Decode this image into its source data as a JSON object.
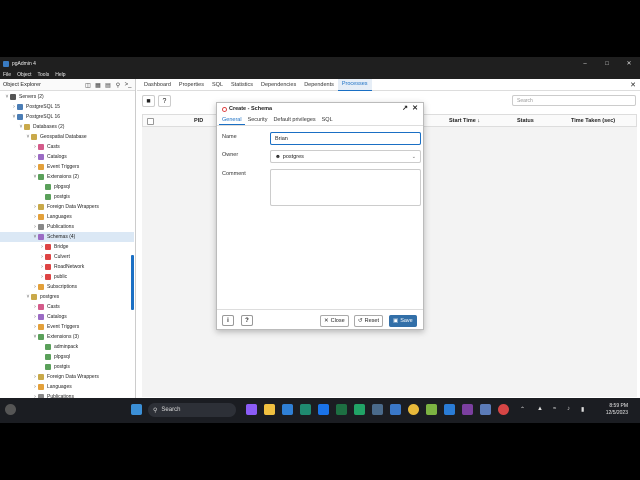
{
  "app": {
    "title": "pgAdmin 4"
  },
  "menu": [
    "File",
    "Object",
    "Tools",
    "Help"
  ],
  "explorer": {
    "title": "Object Explorer",
    "tree": [
      {
        "label": "Servers (2)",
        "indent": 0,
        "chev": "v",
        "color": "#555"
      },
      {
        "label": "PostgreSQL 15",
        "indent": 1,
        "chev": ">",
        "color": "#4b7db5"
      },
      {
        "label": "PostgreSQL 16",
        "indent": 1,
        "chev": "v",
        "color": "#4b7db5"
      },
      {
        "label": "Databases (2)",
        "indent": 2,
        "chev": "v",
        "color": "#c9a94a"
      },
      {
        "label": "Geospatial Database",
        "indent": 3,
        "chev": "v",
        "color": "#c9a94a"
      },
      {
        "label": "Casts",
        "indent": 4,
        "chev": ">",
        "color": "#d45b8a"
      },
      {
        "label": "Catalogs",
        "indent": 4,
        "chev": ">",
        "color": "#9b6bc4"
      },
      {
        "label": "Event Triggers",
        "indent": 4,
        "chev": ">",
        "color": "#e3a03a"
      },
      {
        "label": "Extensions (2)",
        "indent": 4,
        "chev": "v",
        "color": "#5aa05a"
      },
      {
        "label": "plpgsql",
        "indent": 5,
        "chev": "",
        "color": "#5aa05a"
      },
      {
        "label": "postgis",
        "indent": 5,
        "chev": "",
        "color": "#5aa05a"
      },
      {
        "label": "Foreign Data Wrappers",
        "indent": 4,
        "chev": ">",
        "color": "#c9a94a"
      },
      {
        "label": "Languages",
        "indent": 4,
        "chev": ">",
        "color": "#e3a03a"
      },
      {
        "label": "Publications",
        "indent": 4,
        "chev": ">",
        "color": "#888"
      },
      {
        "label": "Schemas (4)",
        "indent": 4,
        "chev": "v",
        "color": "#9b6bc4",
        "selected": true
      },
      {
        "label": "Bridge",
        "indent": 5,
        "chev": ">",
        "color": "#d44"
      },
      {
        "label": "Culvert",
        "indent": 5,
        "chev": ">",
        "color": "#d44"
      },
      {
        "label": "RoadNetwork",
        "indent": 5,
        "chev": ">",
        "color": "#d44"
      },
      {
        "label": "public",
        "indent": 5,
        "chev": ">",
        "color": "#d44"
      },
      {
        "label": "Subscriptions",
        "indent": 4,
        "chev": ">",
        "color": "#e3a03a"
      },
      {
        "label": "postgres",
        "indent": 3,
        "chev": "v",
        "color": "#c9a94a"
      },
      {
        "label": "Casts",
        "indent": 4,
        "chev": ">",
        "color": "#d45b8a"
      },
      {
        "label": "Catalogs",
        "indent": 4,
        "chev": ">",
        "color": "#9b6bc4"
      },
      {
        "label": "Event Triggers",
        "indent": 4,
        "chev": ">",
        "color": "#e3a03a"
      },
      {
        "label": "Extensions (3)",
        "indent": 4,
        "chev": "v",
        "color": "#5aa05a"
      },
      {
        "label": "adminpack",
        "indent": 5,
        "chev": "",
        "color": "#5aa05a"
      },
      {
        "label": "plpgsql",
        "indent": 5,
        "chev": "",
        "color": "#5aa05a"
      },
      {
        "label": "postgis",
        "indent": 5,
        "chev": "",
        "color": "#5aa05a"
      },
      {
        "label": "Foreign Data Wrappers",
        "indent": 4,
        "chev": ">",
        "color": "#c9a94a"
      },
      {
        "label": "Languages",
        "indent": 4,
        "chev": ">",
        "color": "#e3a03a"
      },
      {
        "label": "Publications",
        "indent": 4,
        "chev": ">",
        "color": "#888"
      }
    ]
  },
  "tabs": [
    "Dashboard",
    "Properties",
    "SQL",
    "Statistics",
    "Dependencies",
    "Dependents",
    "Processes"
  ],
  "active_tab": "Processes",
  "processes": {
    "search_placeholder": "Search",
    "columns": {
      "pid": "PID",
      "start": "Start Time ↓",
      "status": "Status",
      "time": "Time Taken (sec)"
    }
  },
  "dialog": {
    "title": "Create - Schema",
    "tabs": [
      "General",
      "Security",
      "Default privileges",
      "SQL"
    ],
    "active_tab": "General",
    "name_label": "Name",
    "name_value": "Brian",
    "owner_label": "Owner",
    "owner_value": "postgres",
    "comment_label": "Comment",
    "comment_value": "",
    "close_label": "Close",
    "reset_label": "Reset",
    "save_label": "Save"
  },
  "taskbar": {
    "search_label": "Search",
    "time": "8:59 PM",
    "date": "12/5/2023"
  },
  "colors": {
    "accent": "#1a6fc4",
    "save": "#326fa8",
    "taskbar": "#1b1d22"
  }
}
